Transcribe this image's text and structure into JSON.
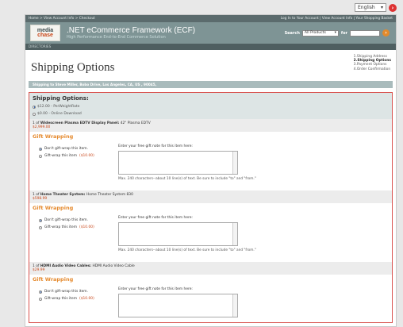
{
  "language": {
    "selected": "English"
  },
  "topnav": {
    "breadcrumb": "Home > View Account Info > Checkout",
    "links": "Log In to Your Account | View Account Info | Your Shopping Basket"
  },
  "header": {
    "logo_line1": "media",
    "logo_line2": "chase",
    "title": ".NET eCommerce Framework (ECF)",
    "subtitle": "High Performance End-to-End Commerce Solution",
    "search_label": "Search",
    "search_select": "All Products",
    "for_label": "for"
  },
  "directories": "DIRECTORIES",
  "steps": [
    "1.Shipping Address",
    "2.Shipping Options",
    "3.Payment Options",
    "4.Order Confirmation"
  ],
  "page_title": "Shipping Options",
  "ship_to": "Shipping to Steve Miller, Bobo Drive, Los Angeles, CA, US , 90045,",
  "shipping": {
    "heading": "Shipping Options:",
    "options": [
      "$12.00 - PerWeightRate",
      "$0.00 - Online Download"
    ]
  },
  "items": [
    {
      "qty": "1 of",
      "name": "Widescreen Plasma EDTV Display Panel:",
      "desc": "42\" Plasma EDTV",
      "price": "$2,999.00",
      "gift_title": "Gift Wrapping",
      "opt1": "Don't gift-wrap this item.",
      "opt2": "Gift-wrap this item",
      "opt2_price": "($10.00)",
      "note_label": "Enter your free gift note for this item here:",
      "max_text": "Max. 240 characters--about 10 line(s) of text. Be sure to include \"to\" and \"from.\""
    },
    {
      "qty": "1 of",
      "name": "Home Theater System:",
      "desc": "Home Theater System 830",
      "price": "$598.99",
      "gift_title": "Gift Wrapping",
      "opt1": "Don't gift-wrap this item.",
      "opt2": "Gift-wrap this item",
      "opt2_price": "($10.00)",
      "note_label": "Enter your free gift note for this item here:",
      "max_text": "Max. 240 characters--about 10 line(s) of text. Be sure to include \"to\" and \"from.\""
    },
    {
      "qty": "1 of",
      "name": "HDMI Audio Video Cables:",
      "desc": "HDMI Audio Video Cable",
      "price": "$29.99",
      "gift_title": "Gift Wrapping",
      "opt1": "Don't gift-wrap this item.",
      "opt2": "Gift-wrap this item",
      "opt2_price": "($10.00)",
      "note_label": "Enter your free gift note for this item here:",
      "max_text": ""
    }
  ],
  "icons": {
    "go": "arrow-right-icon",
    "lang_go": "red-circle-icon"
  }
}
